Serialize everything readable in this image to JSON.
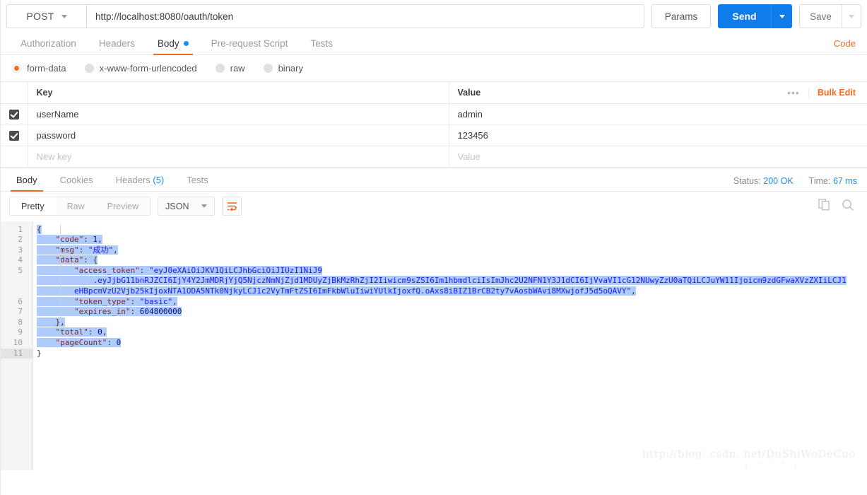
{
  "request": {
    "method": "POST",
    "url": "http://localhost:8080/oauth/token",
    "params_label": "Params",
    "send_label": "Send",
    "save_label": "Save",
    "tabs": [
      {
        "label": "Authorization",
        "active": false,
        "dot": false
      },
      {
        "label": "Headers",
        "active": false,
        "dot": false
      },
      {
        "label": "Body",
        "active": true,
        "dot": true
      },
      {
        "label": "Pre-request Script",
        "active": false,
        "dot": false
      },
      {
        "label": "Tests",
        "active": false,
        "dot": false
      }
    ],
    "code_link": "Code",
    "body_types": [
      {
        "label": "form-data",
        "selected": true
      },
      {
        "label": "x-www-form-urlencoded",
        "selected": false
      },
      {
        "label": "raw",
        "selected": false
      },
      {
        "label": "binary",
        "selected": false
      }
    ],
    "table": {
      "headers": {
        "key": "Key",
        "value": "Value"
      },
      "bulk_edit_label": "Bulk Edit",
      "more_icon": "•••",
      "rows": [
        {
          "checked": true,
          "key": "userName",
          "value": "admin",
          "placeholder": false
        },
        {
          "checked": true,
          "key": "password",
          "value": "123456",
          "placeholder": false
        },
        {
          "checked": false,
          "key": "New key",
          "value": "Value",
          "placeholder": true
        }
      ]
    }
  },
  "response": {
    "tabs": [
      {
        "label": "Body",
        "active": true,
        "count": null
      },
      {
        "label": "Cookies",
        "active": false,
        "count": null
      },
      {
        "label": "Headers",
        "active": false,
        "count": "(5)"
      },
      {
        "label": "Tests",
        "active": false,
        "count": null
      }
    ],
    "status_label": "Status:",
    "status_value": "200 OK",
    "time_label": "Time:",
    "time_value": "67 ms",
    "view_modes": [
      {
        "label": "Pretty",
        "active": true
      },
      {
        "label": "Raw",
        "active": false
      },
      {
        "label": "Preview",
        "active": false
      }
    ],
    "format": "JSON",
    "wrap_icon": "word-wrap-icon",
    "copy_icon": "copy-icon",
    "search_icon": "search-icon",
    "body": {
      "code": 1,
      "msg": "成功",
      "access_token_l1": "eyJ0eXAiOiJKV1QiLCJhbGciOiJIUzI1NiJ9",
      "access_token_l2": ".eyJjbG11bnRJZCI6IjY4Y2JmMDRjYjQ5NjczNmNjZjd1MDUyZjBkMzRhZjI2Iiwicm9sZSI6Im1hbmdlciIsImJhc2U2NFN1Y3J1dCI6IjVvaVI1cG12NUwyZzU0aTQiLCJuYW11Ijoicm9zdGFwaXVzZXIiLCJ1",
      "access_token_l3": "eHBpcmVzU2Vjb25kIjoxNTA1ODA5NTk0NjkyLCJ1c2VyTmFtZSI6ImFkbWluIiwiYUlkIjoxfQ.oAxs8iBIZ1BrCB2ty7vAosbWAvi8MXwjofJ5d5oQAVY",
      "token_type": "basic",
      "expires_in": 604800000,
      "total": 0,
      "pageCount": 0,
      "line_numbers": [
        "1",
        "2",
        "3",
        "4",
        "5",
        "6",
        "7",
        "8",
        "9",
        "10",
        "11"
      ]
    }
  },
  "watermark": {
    "text": "http://blog. csdn. net/DuShiWoDeCuo",
    "text2": "( ˇ ˇ ˇ )"
  }
}
